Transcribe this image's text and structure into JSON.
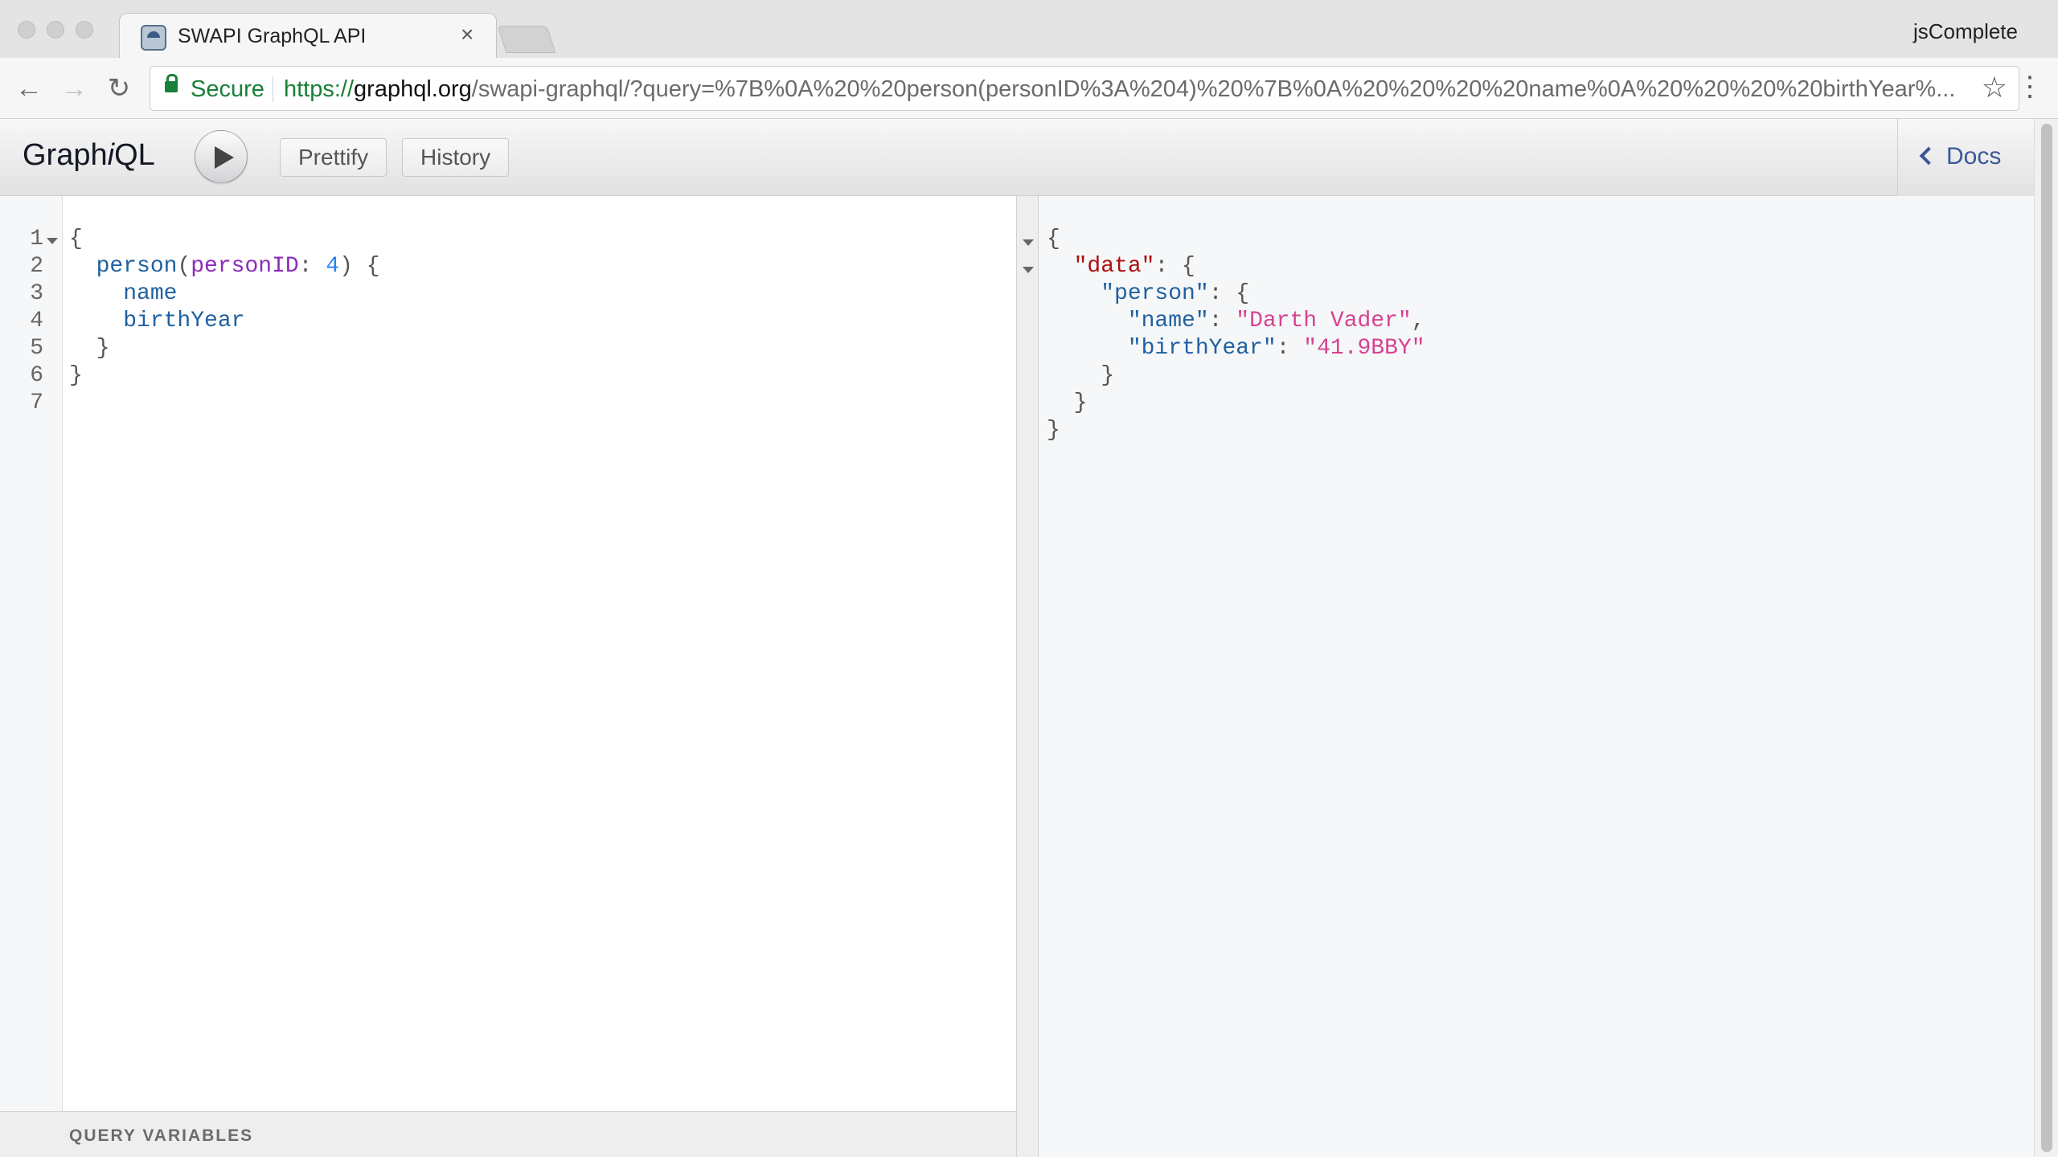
{
  "browser": {
    "tab_title": "SWAPI GraphQL API",
    "tab_close": "×",
    "profile_name": "jsComplete",
    "secure_label": "Secure",
    "url_scheme": "https://",
    "url_host": "graphql.org",
    "url_path": "/swapi-graphql/?query=%7B%0A%20%20person(personID%3A%204)%20%7B%0A%20%20%20%20name%0A%20%20%20%20birthYear%...",
    "back_icon": "←",
    "forward_icon": "→",
    "reload_icon": "↻",
    "star_icon": "☆",
    "menu_icon": "⋮"
  },
  "graphiql": {
    "title_prefix": "Graph",
    "title_italic": "i",
    "title_suffix": "QL",
    "prettify_label": "Prettify",
    "history_label": "History",
    "docs_label": "Docs",
    "query_variables_label": "QUERY VARIABLES"
  },
  "editor": {
    "line_numbers": [
      "1",
      "2",
      "3",
      "4",
      "5",
      "6",
      "7"
    ],
    "query": {
      "open_brace": "{",
      "field_person": "person",
      "paren_open": "(",
      "arg_name": "personID",
      "colon": ": ",
      "arg_value": "4",
      "paren_close_brace": ") {",
      "field_name": "name",
      "field_birthyear": "birthYear",
      "inner_close": "}",
      "outer_close": "}"
    }
  },
  "result": {
    "open_brace": "{",
    "key_data": "\"data\"",
    "key_person": "\"person\"",
    "key_name": "\"name\"",
    "value_name": "\"Darth Vader\"",
    "key_birthyear": "\"birthYear\"",
    "value_birthyear": "\"41.9BBY\"",
    "colon_brace": ": {",
    "colon": ": ",
    "comma": ",",
    "close_brace": "}"
  },
  "colors": {
    "field": "#1f61a0",
    "argument": "#8b2bb9",
    "number": "#2882f9",
    "property": "#a11",
    "string": "#d64292",
    "secure": "#188038",
    "docs_link": "#3b5998"
  }
}
